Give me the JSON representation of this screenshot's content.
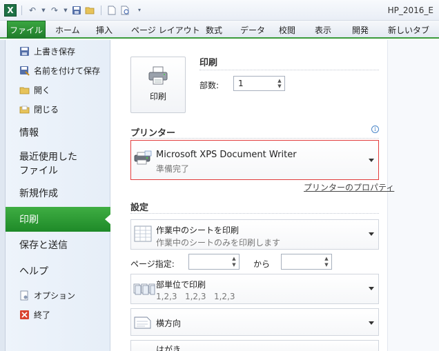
{
  "titlebar": {
    "logo": "X",
    "title": "HP_2016_E",
    "icons": [
      "excel-logo-icon",
      "undo-icon",
      "redo-icon",
      "save-icon",
      "open-folder-icon",
      "new-doc-icon",
      "print-preview-icon",
      "customize-qat-icon"
    ]
  },
  "ribbon": {
    "file_tab": "ファイル",
    "tabs": [
      "ホーム",
      "挿入",
      "ページ レイアウト",
      "数式",
      "データ",
      "校閲",
      "表示",
      "開発",
      "新しいタブ"
    ]
  },
  "nav": {
    "small_top": [
      {
        "label": "上書き保存",
        "icon": "save-icon"
      },
      {
        "label": "名前を付けて保存",
        "icon": "save-as-icon"
      },
      {
        "label": "開く",
        "icon": "open-folder-icon"
      },
      {
        "label": "閉じる",
        "icon": "close-folder-icon"
      }
    ],
    "info": "情報",
    "recent_line1": "最近使用した",
    "recent_line2": "ファイル",
    "new": "新規作成",
    "print": "印刷",
    "save_send": "保存と送信",
    "help": "ヘルプ",
    "small_bottom": [
      {
        "label": "オプション",
        "icon": "options-icon"
      },
      {
        "label": "終了",
        "icon": "exit-icon"
      }
    ]
  },
  "print": {
    "section_title": "印刷",
    "button_label": "印刷",
    "copies_label": "部数:",
    "copies_value": "1"
  },
  "printer": {
    "section_title": "プリンター",
    "name": "Microsoft XPS Document Writer",
    "status": "準備完了",
    "properties_link": "プリンターのプロパティ"
  },
  "settings": {
    "section_title": "設定",
    "sheet_main": "作業中のシートを印刷",
    "sheet_sub": "作業中のシートのみを印刷します",
    "pages_label": "ページ指定:",
    "pages_to": "から",
    "pages_from_value": "",
    "pages_to_value": "",
    "collate_main": "部単位で印刷",
    "collate_sub": "1,2,3   1,2,3   1,2,3",
    "orientation": "横方向",
    "paper": "はがき"
  },
  "colors": {
    "file_green": "#2a9136",
    "highlight_red": "#e23b3b"
  }
}
